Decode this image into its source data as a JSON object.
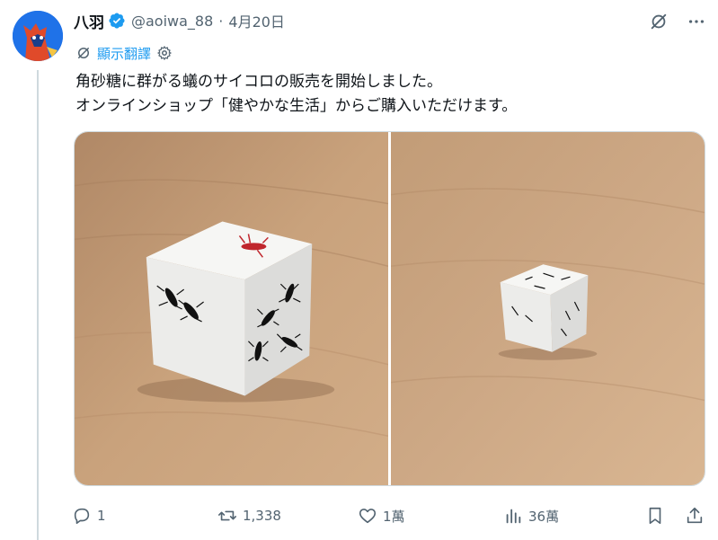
{
  "author": {
    "name": "八羽",
    "handle": "@aoiwa_88",
    "separator": "·",
    "date": "4月20日",
    "verified": true
  },
  "translate": {
    "label": "顯示翻譯",
    "icon": "translate-icon",
    "settings_icon": "gear-icon"
  },
  "tweet": {
    "line1": "角砂糖に群がる蟻のサイコロの販売を開始しました。",
    "line2": "オンラインショップ「健やかな生活」からご購入いただけます。"
  },
  "media": [
    {
      "alt": "close-up of white die with ants"
    },
    {
      "alt": "small white die with ants on wooden table"
    }
  ],
  "actions": {
    "reply": {
      "count": "1",
      "icon": "reply-icon"
    },
    "retweet": {
      "count": "1,338",
      "icon": "retweet-icon"
    },
    "like": {
      "count": "1萬",
      "icon": "heart-icon"
    },
    "views": {
      "count": "36萬",
      "icon": "views-icon"
    },
    "bookmark": {
      "icon": "bookmark-icon"
    },
    "share": {
      "icon": "share-icon"
    }
  },
  "colors": {
    "accent": "#1d9bf0",
    "text_secondary": "#536471",
    "wood": "#c8a27e"
  }
}
